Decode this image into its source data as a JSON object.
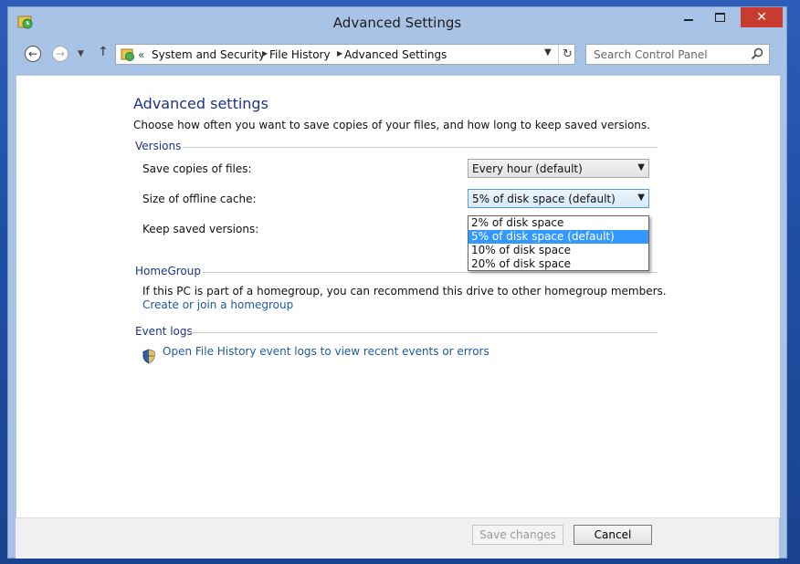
{
  "window": {
    "title": "Advanced Settings",
    "close_glyph": "✕"
  },
  "nav": {
    "back_glyph": "←",
    "forward_glyph": "→",
    "recent_glyph": "▼",
    "up_glyph": "↑",
    "overflow_glyph": "«",
    "breadcrumbs": [
      "System and Security",
      "File History",
      "Advanced Settings"
    ],
    "refresh_glyph": "↻",
    "search_placeholder": "Search Control Panel"
  },
  "main": {
    "heading": "Advanced settings",
    "description": "Choose how often you want to save copies of your files, and how long to keep saved versions.",
    "versions": {
      "title": "Versions",
      "save_copies_label": "Save copies of files:",
      "save_copies_value": "Every hour (default)",
      "offline_cache_label": "Size of offline cache:",
      "offline_cache_value": "5% of disk space (default)",
      "keep_versions_label": "Keep saved versions:",
      "dropdown_options": [
        "2% of disk space",
        "5% of disk space (default)",
        "10% of disk space",
        "20% of disk space"
      ]
    },
    "homegroup": {
      "title": "HomeGroup",
      "text": "If this PC is part of a homegroup, you can recommend this drive to other homegroup members.",
      "link": "Create or join a homegroup"
    },
    "event_logs": {
      "title": "Event logs",
      "link": "Open File History event logs to view recent events or errors"
    }
  },
  "footer": {
    "save_label": "Save changes",
    "cancel_label": "Cancel"
  },
  "colors": {
    "accent": "#1e3287",
    "link": "#1f5aa3",
    "selection": "#3399ff",
    "close": "#c83c30"
  }
}
